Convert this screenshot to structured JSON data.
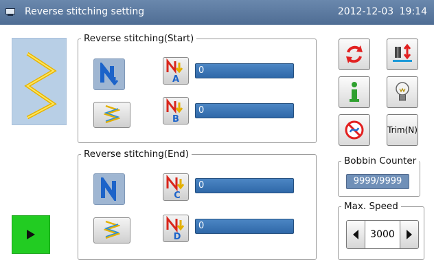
{
  "window": {
    "title": "Reverse stitching setting",
    "date": "2012-12-03",
    "time": "19:14"
  },
  "start": {
    "legend": "Reverse stitching(Start)",
    "field_a": {
      "letter": "A",
      "value": "0"
    },
    "field_b": {
      "letter": "B",
      "value": "0"
    }
  },
  "end": {
    "legend": "Reverse stitching(End)",
    "field_c": {
      "letter": "C",
      "value": "0"
    },
    "field_d": {
      "letter": "D",
      "value": "0"
    }
  },
  "tools": {
    "trim_label": "Trim(N)"
  },
  "bobbin": {
    "legend": "Bobbin Counter",
    "value": "9999/9999"
  },
  "speed": {
    "legend": "Max. Speed",
    "value": "3000"
  },
  "colors": {
    "title_bar": "#5a7aa2",
    "field_blue": "#3a74b4",
    "preview_bg": "#b8cfe6",
    "stitch_yellow": "#f2c200",
    "play_green": "#22cc22"
  }
}
